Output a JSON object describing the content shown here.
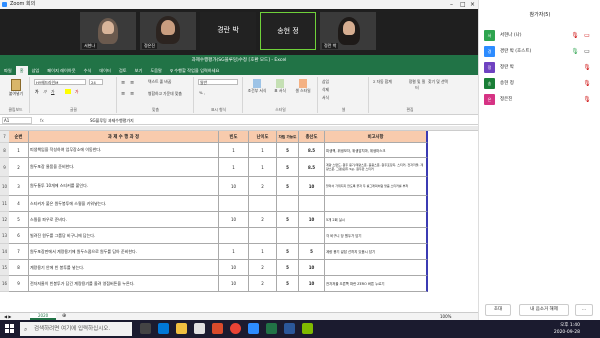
{
  "zoom": {
    "window_title": "Zoom 회의",
    "participants_video": [
      {
        "name": "서현나"
      },
      {
        "name": "정은진"
      },
      {
        "name": "경란 박"
      },
      {
        "name": "송현 정"
      },
      {
        "name": "정란 박"
      }
    ]
  },
  "excel": {
    "title": "과제수행평가(SG블루밍)수정 [호환 모드] - Excel",
    "tabs": [
      "파일",
      "홈",
      "삽입",
      "페이지 레이아웃",
      "수식",
      "데이터",
      "검토",
      "보기",
      "도움말",
      "♀ 수행할 작업을 입력하세요"
    ],
    "ribbon": {
      "paste": "붙여넣기",
      "clipboard": "클립보드",
      "font_name": "HY헤드라인M",
      "font_size": "24",
      "font_group": "글꼴",
      "wrap_text": "텍스트 줄 바꿈",
      "merge": "병합하고 가운데 맞춤",
      "align_group": "맞춤",
      "number_format": "일반",
      "number_group": "표시 형식",
      "conditional": "조건부 서식",
      "format_table": "표 서식",
      "cell_styles": "셀 스타일",
      "style_group": "스타일",
      "insert": "삽입",
      "delete": "삭제",
      "format": "서식",
      "cells_group": "셀",
      "autosum": "자동 합계",
      "sort": "정렬 및 필터",
      "find": "찾기 및 선택",
      "edit_group": "편집"
    },
    "name_box": "A1",
    "formula": "SG블루밍 과제수행평가지",
    "headers": {
      "num": "순번",
      "task": "과 제 수 행 과 정",
      "freq": "빈도",
      "diff": "난이도",
      "indep": "자립 가능도",
      "total": "총산도",
      "note": "비고사항"
    },
    "rows": [
      {
        "r": "8",
        "num": "1",
        "task": "피생책임을 작성하여 업무장소에 이동한다.",
        "freq": "1",
        "diff": "1",
        "indep": "5",
        "total": "8.5",
        "note": "피생책, 위생모자, 위생앞치마, 위생마스크"
      },
      {
        "r": "9",
        "num": "2",
        "task": "원두포장 물품을 준비한다.",
        "freq": "1",
        "diff": "1",
        "indep": "5",
        "total": "8.5",
        "note": "계량 스탠드, 원두 용기/계량스푼, 홀용스푼, 원두포장지, 스티커, 전자저울, 계량스푼, 그램(원두 5g), 원두판 스티커"
      },
      {
        "r": "10",
        "num": "3",
        "task": "원두통투 10개에 스티커를 붙인다.",
        "freq": "10",
        "diff": "2",
        "indep": "5",
        "total": "10",
        "note": "잘라서 가위지지 않도록 끝자 두 룰그래픽처럼 맞춤 스티커를 부착"
      },
      {
        "r": "11",
        "num": "4",
        "task": "스티커가 붙은 원두봉투에 스윙을 키워넣는다.",
        "freq": "",
        "diff": "",
        "indep": "",
        "total": "",
        "note": ""
      },
      {
        "r": "12",
        "num": "5",
        "task": "스윙을 파우로 준비다.",
        "freq": "10",
        "diff": "2",
        "indep": "5",
        "total": "10",
        "note": "5개 2회 실시"
      },
      {
        "r": "13",
        "num": "6",
        "task": "빌려진 원두를 그룹당 비구니에 담는다.",
        "freq": "",
        "diff": "",
        "indep": "",
        "total": "",
        "note": "각 비구니 당 원두가 담기"
      },
      {
        "r": "14",
        "num": "7",
        "task": "원두포장판에서 계량용기에 원두스쿱으로 원두를 담아 준비한다.",
        "freq": "1",
        "diff": "1",
        "indep": "5",
        "total": "5",
        "note": "계량 용기 겉잡 선까지 있음시 담기"
      },
      {
        "r": "15",
        "num": "8",
        "task": "계량용기 안에 빈 봉투를 넣는다.",
        "freq": "10",
        "diff": "2",
        "indep": "5",
        "total": "10",
        "note": ""
      },
      {
        "r": "16",
        "num": "9",
        "task": "전자저울이 빈봉투가 담긴 계량용기를 올려 영점버튼을 누른다.",
        "freq": "10",
        "diff": "2",
        "indep": "5",
        "total": "10",
        "note": "전자저울 오른쪽 파란 ZERO 버튼 누르기"
      }
    ],
    "sheet_tab": "2020",
    "status": "준비",
    "zoom_level": "100%"
  },
  "sidebar": {
    "header": "참가자(5)",
    "participants": [
      {
        "name": "서현나 (나)",
        "color": "#2ea44f",
        "initial": "서",
        "mic": "muted",
        "video": "off"
      },
      {
        "name": "경란 박 (호스트)",
        "color": "#2d8cff",
        "initial": "경",
        "mic": "on",
        "video": "on"
      },
      {
        "name": "정란 박",
        "color": "#6f42c1",
        "initial": "정",
        "mic": "muted",
        "video": "off"
      },
      {
        "name": "송현 정",
        "color": "#1a7f37",
        "initial": "송",
        "mic": "muted",
        "video": "off"
      },
      {
        "name": "정은진",
        "color": "#d63384",
        "initial": "은",
        "mic": "muted",
        "video": "off"
      }
    ],
    "invite": "초대",
    "mute_me": "내 음소거 해제",
    "more": "..."
  },
  "taskbar": {
    "search_placeholder": "검색하려면 여기에 입력하십시오.",
    "time": "오후 1:40",
    "date": "2020-09-28"
  }
}
